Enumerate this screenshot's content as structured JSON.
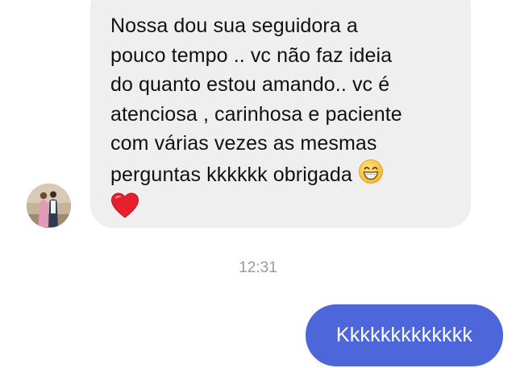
{
  "conversation": {
    "incoming_message": {
      "text": "Nossa dou sua seguidora a\npouco tempo .. vc não faz ideia\ndo quanto estou amando.. vc é\natenciosa , carinhosa e paciente\ncom várias vezes as mesmas\nperguntas kkkkkk obrigada",
      "emojis": [
        "grinning-face-with-smiling-eyes",
        "red-heart"
      ],
      "bubble_color": "#efefef"
    },
    "timestamp": "12:31",
    "outgoing_message": {
      "text": "Kkkkkkkkkkkkk",
      "bubble_color": "#4d67db"
    }
  }
}
